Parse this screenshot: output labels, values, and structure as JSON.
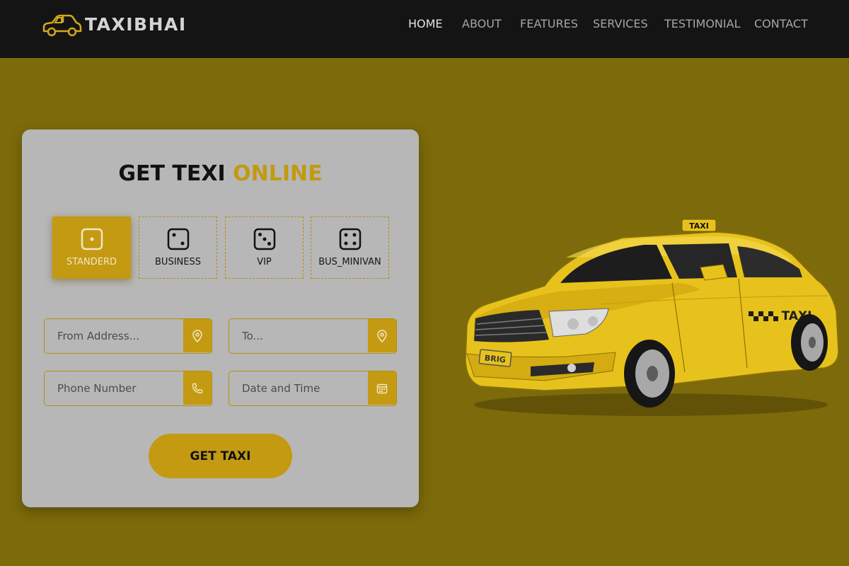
{
  "brand": {
    "name": "TAXIBHAI",
    "logo_icon": "car-icon"
  },
  "nav": {
    "items": [
      {
        "label": "HOME",
        "active": true
      },
      {
        "label": "ABOUT"
      },
      {
        "label": "FEATURES"
      },
      {
        "label": "SERVICES"
      },
      {
        "label": "TESTIMONIAL"
      },
      {
        "label": "CONTACT"
      }
    ]
  },
  "form": {
    "title_part1": "GET TEXI",
    "title_part2": "ONLINE",
    "car_types": [
      {
        "label": "STANDERD",
        "icon": "dice-one-icon",
        "selected": true
      },
      {
        "label": "BUSINESS",
        "icon": "dice-two-icon"
      },
      {
        "label": "VIP",
        "icon": "dice-three-icon"
      },
      {
        "label": "BUS_MINIVAN",
        "icon": "dice-four-icon"
      }
    ],
    "fields": {
      "from": {
        "placeholder": "From Address...",
        "value": "",
        "icon": "map-pin-icon"
      },
      "to": {
        "placeholder": "To...",
        "value": "",
        "icon": "map-pin-icon"
      },
      "phone": {
        "placeholder": "Phone Number",
        "value": "",
        "icon": "phone-icon"
      },
      "datetime": {
        "placeholder": "Date and Time",
        "value": "",
        "icon": "calendar-icon"
      }
    },
    "submit_label": "GET TAXI"
  },
  "hero_car": {
    "roof_sign": "TAXI",
    "door_text": "TAXI",
    "plate": "BRIG"
  },
  "colors": {
    "accent": "#c39a11",
    "background": "#7d6a0a",
    "header": "#141414",
    "card": "#b7b7b7",
    "car_body": "#e8c21c"
  }
}
